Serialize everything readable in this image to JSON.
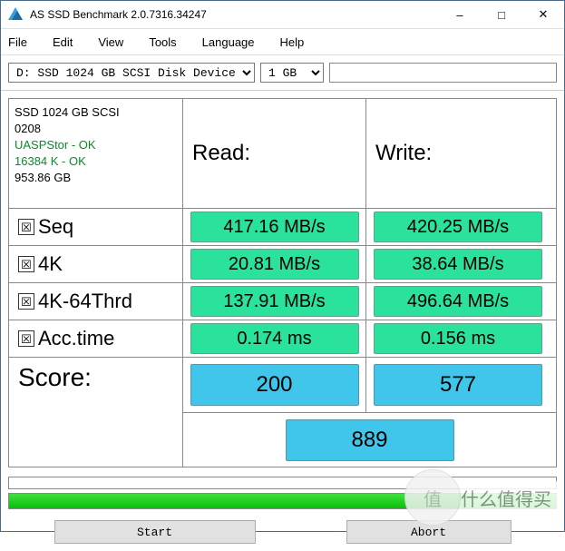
{
  "window": {
    "title": "AS SSD Benchmark 2.0.7316.34247"
  },
  "menu": {
    "file": "File",
    "edit": "Edit",
    "view": "View",
    "tools": "Tools",
    "language": "Language",
    "help": "Help"
  },
  "toolbar": {
    "disk": "D: SSD 1024 GB SCSI Disk Device",
    "size": "1 GB"
  },
  "drive": {
    "name": "SSD 1024 GB SCSI",
    "rev": "0208",
    "driver": "UASPStor - OK",
    "align": "16384 K - OK",
    "capacity": "953.86 GB"
  },
  "headers": {
    "read": "Read:",
    "write": "Write:",
    "score": "Score:"
  },
  "labels": {
    "seq": "Seq",
    "k4": "4K",
    "k4t": "4K-64Thrd",
    "acc": "Acc.time"
  },
  "check": "☒",
  "results": {
    "seq": {
      "read": "417.16 MB/s",
      "write": "420.25 MB/s"
    },
    "k4": {
      "read": "20.81 MB/s",
      "write": "38.64 MB/s"
    },
    "k4t": {
      "read": "137.91 MB/s",
      "write": "496.64 MB/s"
    },
    "acc": {
      "read": "0.174 ms",
      "write": "0.156 ms"
    }
  },
  "scores": {
    "read": "200",
    "write": "577",
    "total": "889"
  },
  "buttons": {
    "start": "Start",
    "abort": "Abort"
  },
  "watermark": {
    "logo": "值",
    "text": "什么值得买"
  }
}
